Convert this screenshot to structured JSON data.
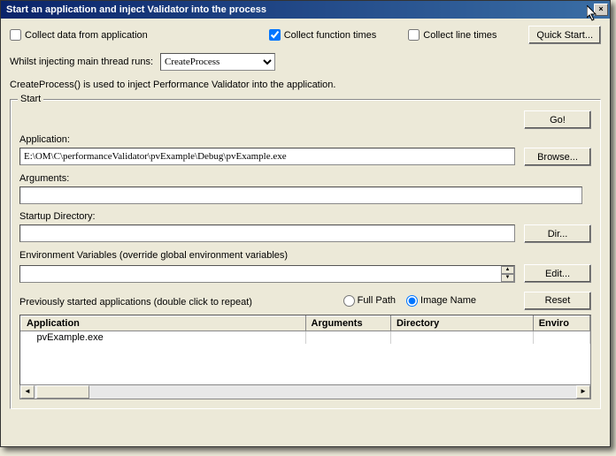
{
  "titlebar": {
    "title": "Start an application and inject Validator into the process",
    "close": "×"
  },
  "topRow": {
    "collect_data": "Collect data from application",
    "collect_fn": "Collect function times",
    "collect_line": "Collect line times",
    "quick_start": "Quick Start..."
  },
  "inject": {
    "label": "Whilst injecting main thread runs:",
    "value": "CreateProcess"
  },
  "description": "CreateProcess() is used to inject Performance Validator into the application.",
  "startGroup": {
    "legend": "Start",
    "go": "Go!",
    "app_label": "Application:",
    "app_value": "E:\\OM\\C\\performanceValidator\\pvExample\\Debug\\pvExample.exe",
    "browse": "Browse...",
    "args_label": "Arguments:",
    "args_value": "",
    "startdir_label": "Startup Directory:",
    "startdir_value": "",
    "dir": "Dir...",
    "env_label": "Environment Variables (override global environment variables)",
    "edit": "Edit...",
    "prev_label": "Previously started applications (double click to repeat)",
    "full_path": "Full Path",
    "image_name": "Image Name",
    "reset": "Reset"
  },
  "table": {
    "headers": [
      "Application",
      "Arguments",
      "Directory",
      "Enviro"
    ],
    "rows": [
      {
        "app": "pvExample.exe",
        "args": "",
        "dir": "",
        "env": ""
      }
    ]
  }
}
